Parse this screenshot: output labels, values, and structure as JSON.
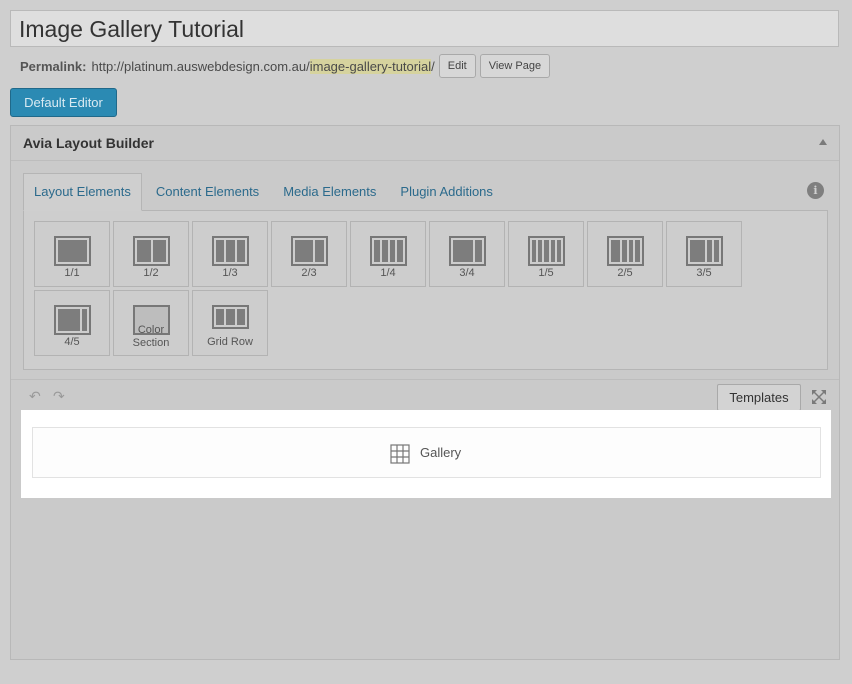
{
  "post": {
    "title": "Image Gallery Tutorial",
    "permalink_label": "Permalink:",
    "permalink_base": "http://platinum.auswebdesign.com.au/",
    "permalink_slug": "image-gallery-tutorial",
    "permalink_tail": "/",
    "edit_label": "Edit",
    "view_page_label": "View Page"
  },
  "default_editor_label": "Default Editor",
  "builder": {
    "title": "Avia Layout Builder",
    "tabs": [
      {
        "label": "Layout Elements",
        "active": true
      },
      {
        "label": "Content Elements",
        "active": false
      },
      {
        "label": "Media Elements",
        "active": false
      },
      {
        "label": "Plugin Additions",
        "active": false
      }
    ],
    "info_icon": "i",
    "elements": [
      {
        "label": "1/1"
      },
      {
        "label": "1/2"
      },
      {
        "label": "1/3"
      },
      {
        "label": "2/3"
      },
      {
        "label": "1/4"
      },
      {
        "label": "3/4"
      },
      {
        "label": "1/5"
      },
      {
        "label": "2/5"
      },
      {
        "label": "3/5"
      },
      {
        "label": "4/5"
      },
      {
        "label_line1": "Color",
        "label_line2": "Section"
      },
      {
        "label": "Grid Row"
      }
    ],
    "undo_icon": "↶",
    "redo_icon": "↷",
    "templates_label": "Templates",
    "canvas": {
      "items": [
        {
          "label": "Gallery",
          "icon": "grid-icon"
        }
      ]
    }
  },
  "colors": {
    "accent": "#2b8ab3",
    "tab_link": "#2b6a8c",
    "slug_highlight": "#d6d39e"
  }
}
